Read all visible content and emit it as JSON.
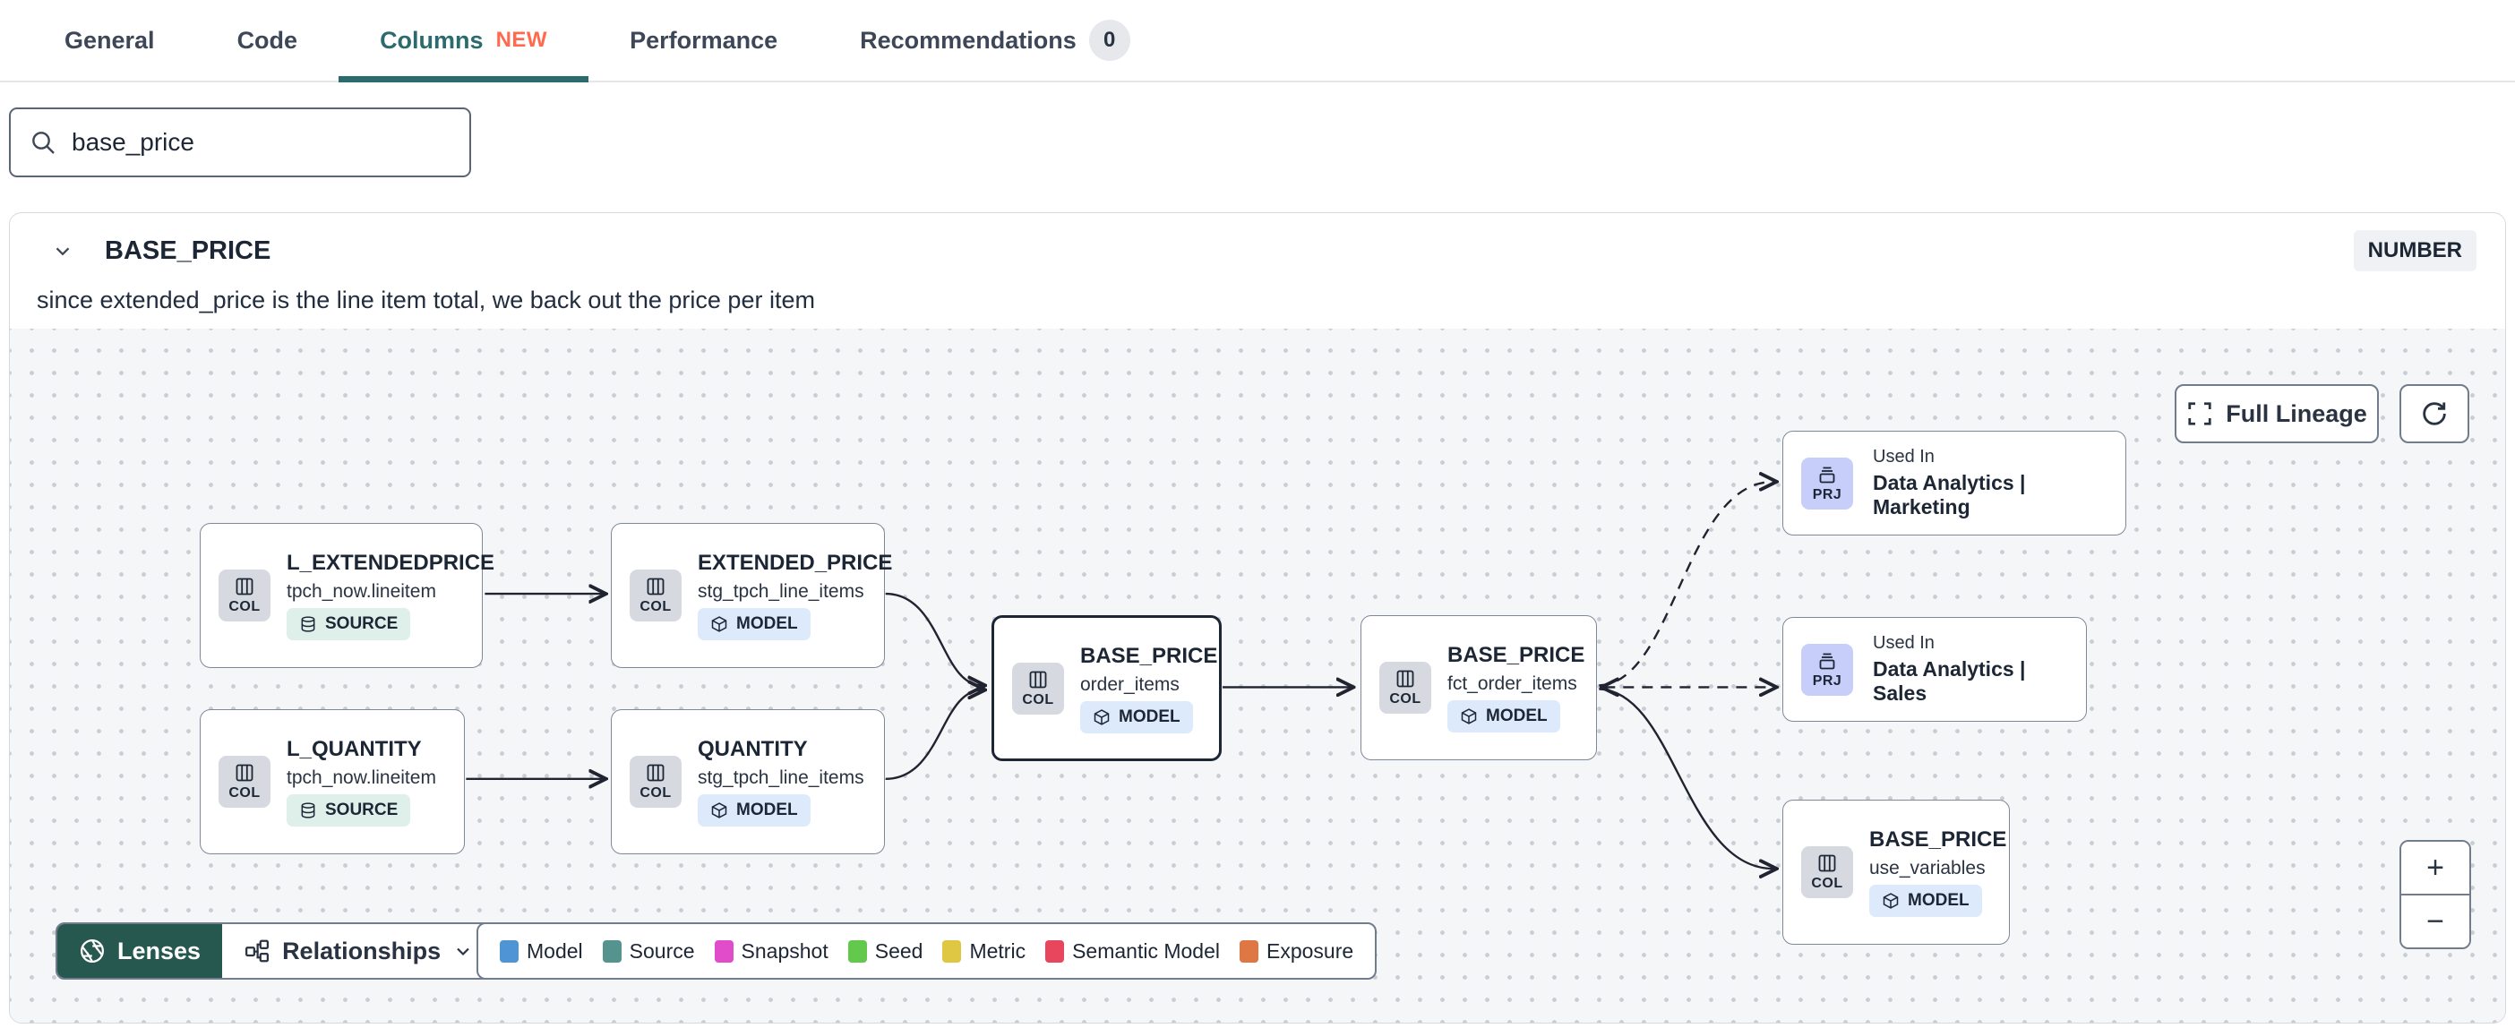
{
  "tabs": {
    "general": "General",
    "code": "Code",
    "columns": "Columns",
    "columns_badge": "NEW",
    "performance": "Performance",
    "recommendations": "Recommendations",
    "recommendations_count": "0"
  },
  "search": {
    "value": "base_price"
  },
  "column": {
    "name": "BASE_PRICE",
    "data_type": "NUMBER",
    "description": "since extended_price is the line item total, we back out the price per item"
  },
  "lineage": {
    "nodes": [
      {
        "chip": "COL",
        "title": "L_EXTENDEDPRICE",
        "subtitle": "tpch_now.lineitem",
        "badge": "SOURCE"
      },
      {
        "chip": "COL",
        "title": "L_QUANTITY",
        "subtitle": "tpch_now.lineitem",
        "badge": "SOURCE"
      },
      {
        "chip": "COL",
        "title": "EXTENDED_PRICE",
        "subtitle": "stg_tpch_line_items",
        "badge": "MODEL"
      },
      {
        "chip": "COL",
        "title": "QUANTITY",
        "subtitle": "stg_tpch_line_items",
        "badge": "MODEL"
      },
      {
        "chip": "COL",
        "title": "BASE_PRICE",
        "subtitle": "order_items",
        "badge": "MODEL",
        "selected": true
      },
      {
        "chip": "COL",
        "title": "BASE_PRICE",
        "subtitle": "fct_order_items",
        "badge": "MODEL"
      },
      {
        "chip": "PRJ",
        "kicker": "Used In",
        "title": "Data Analytics | Marketing"
      },
      {
        "chip": "PRJ",
        "kicker": "Used In",
        "title": "Data Analytics | Sales"
      },
      {
        "chip": "COL",
        "title": "BASE_PRICE",
        "subtitle": "use_variables",
        "badge": "MODEL"
      }
    ],
    "controls": {
      "full_lineage": "Full Lineage",
      "lenses": "Lenses",
      "relationships": "Relationships",
      "zoom_in": "+",
      "zoom_out": "−"
    },
    "legend": {
      "items": [
        {
          "label": "Model",
          "color": "#4f94d4"
        },
        {
          "label": "Source",
          "color": "#55948e"
        },
        {
          "label": "Snapshot",
          "color": "#e14ccb"
        },
        {
          "label": "Seed",
          "color": "#62c94d"
        },
        {
          "label": "Metric",
          "color": "#dfc643"
        },
        {
          "label": "Semantic Model",
          "color": "#e8465c"
        },
        {
          "label": "Exposure",
          "color": "#de7743"
        }
      ]
    }
  },
  "icons": {
    "search": "magnifier",
    "expander": "chevron-down",
    "col_chip": "columns",
    "source_badge": "database-cylinder",
    "model_badge": "cube",
    "prj_chip": "archive-box",
    "lenses": "aperture",
    "relationships": "node-graph",
    "full_lineage": "expand-corners",
    "refresh": "circular-arrow"
  }
}
